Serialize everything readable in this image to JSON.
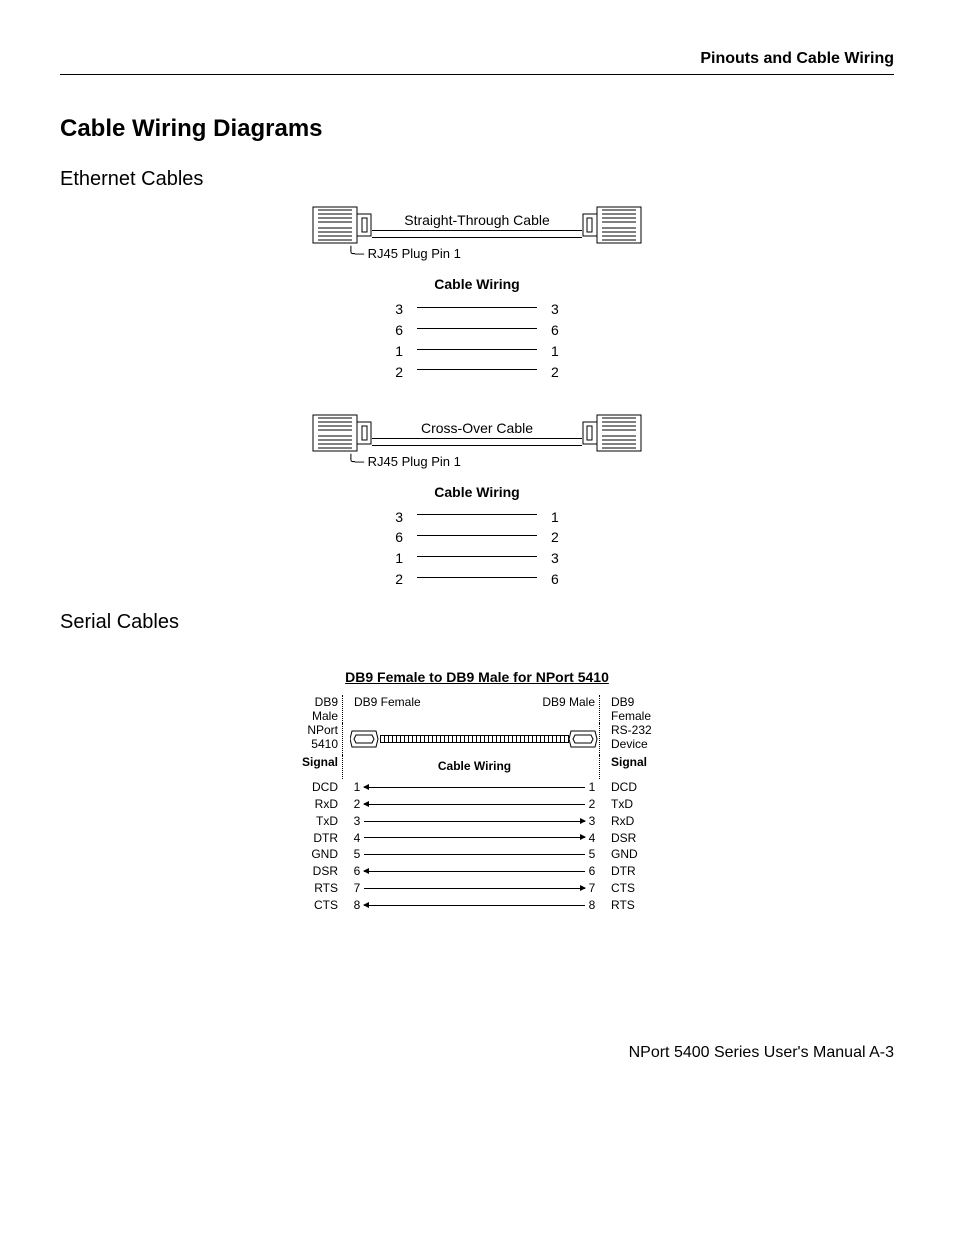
{
  "header": "Pinouts and Cable Wiring",
  "title": "Cable Wiring Diagrams",
  "section1": "Ethernet Cables",
  "straight": {
    "label": "Straight-Through Cable",
    "callout": "RJ45 Plug Pin 1",
    "cw": "Cable Wiring",
    "rows": [
      {
        "l": "3",
        "r": "3"
      },
      {
        "l": "6",
        "r": "6"
      },
      {
        "l": "1",
        "r": "1"
      },
      {
        "l": "2",
        "r": "2"
      }
    ]
  },
  "cross": {
    "label": "Cross-Over Cable",
    "callout": "RJ45 Plug Pin 1",
    "cw": "Cable Wiring",
    "rows": [
      {
        "l": "3",
        "r": "1"
      },
      {
        "l": "6",
        "r": "2"
      },
      {
        "l": "1",
        "r": "3"
      },
      {
        "l": "2",
        "r": "6"
      }
    ]
  },
  "section2": "Serial Cables",
  "serial": {
    "title": "DB9 Female to DB9 Male for NPort 5410",
    "left_top": "DB9 Male",
    "right_top": "DB9 Female",
    "mid_left": "DB9 Female",
    "mid_right": "DB9 Male",
    "left_mid": "NPort 5410",
    "right_mid": "RS-232 Device",
    "signal": "Signal",
    "cw": "Cable Wiring",
    "rows": [
      {
        "ls": "DCD",
        "ln": "1",
        "rn": "1",
        "rs": "DCD",
        "dir": "l"
      },
      {
        "ls": "RxD",
        "ln": "2",
        "rn": "2",
        "rs": "TxD",
        "dir": "l"
      },
      {
        "ls": "TxD",
        "ln": "3",
        "rn": "3",
        "rs": "RxD",
        "dir": "r"
      },
      {
        "ls": "DTR",
        "ln": "4",
        "rn": "4",
        "rs": "DSR",
        "dir": "r"
      },
      {
        "ls": "GND",
        "ln": "5",
        "rn": "5",
        "rs": "GND",
        "dir": ""
      },
      {
        "ls": "DSR",
        "ln": "6",
        "rn": "6",
        "rs": "DTR",
        "dir": "l"
      },
      {
        "ls": "RTS",
        "ln": "7",
        "rn": "7",
        "rs": "CTS",
        "dir": "r"
      },
      {
        "ls": "CTS",
        "ln": "8",
        "rn": "8",
        "rs": "RTS",
        "dir": "l"
      }
    ]
  },
  "footer": "NPort 5400 Series User's Manual   A-3"
}
